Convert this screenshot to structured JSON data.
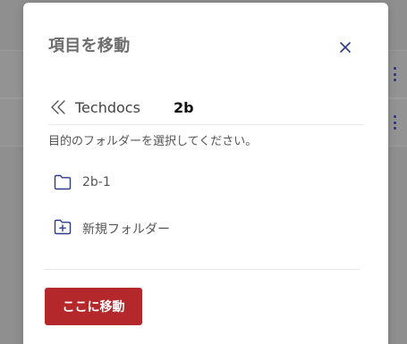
{
  "dialog": {
    "title": "項目を移動",
    "instruction": "目的のフォルダーを選択してください。",
    "breadcrumb": {
      "root_label": "Techdocs",
      "current_label": "2b"
    },
    "folders": [
      {
        "label": "2b-1",
        "icon": "folder-icon"
      },
      {
        "label": "新規フォルダー",
        "icon": "new-folder-icon"
      }
    ],
    "move_button_label": "ここに移動",
    "close_icon": "close-icon"
  },
  "colors": {
    "accent_icon": "#2d3a8c",
    "primary_button": "#b4282b",
    "overlay": "#8f8f8f"
  }
}
